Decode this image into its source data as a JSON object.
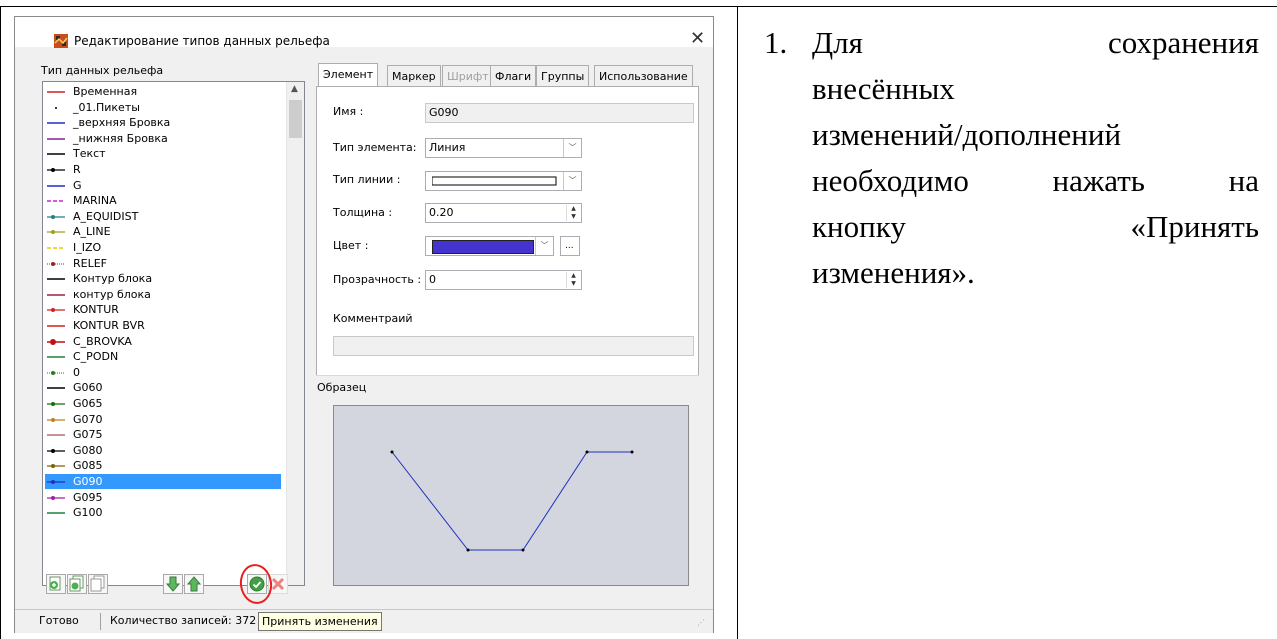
{
  "dialog": {
    "title": "Редактирование типов данных рельефа",
    "close_symbol": "✕",
    "list_label": "Тип данных рельефа",
    "list_items": [
      {
        "label": "Временная",
        "color": "#d02020",
        "style": "line"
      },
      {
        "label": "_01.Пикеты",
        "color": "#000000",
        "style": "dot"
      },
      {
        "label": "_верхняя Бровка",
        "color": "#2030c0",
        "style": "line"
      },
      {
        "label": "_нижняя Бровка",
        "color": "#8a2090",
        "style": "line"
      },
      {
        "label": "Текст",
        "color": "#000000",
        "style": "line"
      },
      {
        "label": "R",
        "color": "#000000",
        "style": "marker"
      },
      {
        "label": "G",
        "color": "#2030c0",
        "style": "line"
      },
      {
        "label": "MARINA",
        "color": "#d020d0",
        "style": "dash"
      },
      {
        "label": "A_EQUIDIST",
        "color": "#208080",
        "style": "marker"
      },
      {
        "label": "A_LINE",
        "color": "#a0a020",
        "style": "marker"
      },
      {
        "label": "I_IZO",
        "color": "#e0d000",
        "style": "dash"
      },
      {
        "label": "RELEF",
        "color": "#a02020",
        "style": "dotmarker"
      },
      {
        "label": "Контур блока",
        "color": "#000000",
        "style": "line"
      },
      {
        "label": "контур блока",
        "color": "#a02040",
        "style": "line"
      },
      {
        "label": "KONTUR",
        "color": "#d02020",
        "style": "marker"
      },
      {
        "label": "KONTUR BVR",
        "color": "#d02020",
        "style": "line"
      },
      {
        "label": "C_BROVKA",
        "color": "#c01010",
        "style": "bigmarker"
      },
      {
        "label": "C_PODN",
        "color": "#208040",
        "style": "line"
      },
      {
        "label": "0",
        "color": "#208020",
        "style": "dotmarker"
      },
      {
        "label": "G060",
        "color": "#000000",
        "style": "line"
      },
      {
        "label": "G065",
        "color": "#107010",
        "style": "marker"
      },
      {
        "label": "G070",
        "color": "#c08020",
        "style": "marker"
      },
      {
        "label": "G075",
        "color": "#b07070",
        "style": "line"
      },
      {
        "label": "G080",
        "color": "#000000",
        "style": "marker"
      },
      {
        "label": "G085",
        "color": "#806000",
        "style": "marker"
      },
      {
        "label": "G090",
        "color": "#2030c0",
        "style": "marker"
      },
      {
        "label": "G095",
        "color": "#a020a0",
        "style": "marker"
      },
      {
        "label": "G100",
        "color": "#208040",
        "style": "line"
      }
    ],
    "selected_index": 25,
    "tabs": [
      {
        "label": "Элемент",
        "active": true,
        "disabled": false
      },
      {
        "label": "Маркер",
        "active": false,
        "disabled": false
      },
      {
        "label": "Шрифт",
        "active": false,
        "disabled": true
      },
      {
        "label": "Флаги",
        "active": false,
        "disabled": false
      },
      {
        "label": "Группы",
        "active": false,
        "disabled": false
      },
      {
        "label": "Использование",
        "active": false,
        "disabled": false
      }
    ],
    "form": {
      "name_label": "Имя :",
      "name_value": "G090",
      "element_type_label": "Тип элемента:",
      "element_type_value": "Линия",
      "line_type_label": "Тип линии :",
      "thickness_label": "Толщина :",
      "thickness_value": "0.20",
      "color_label": "Цвет :",
      "color_value": "#4433cc",
      "color_more": "...",
      "transparency_label": "Прозрачность :",
      "transparency_value": "0",
      "comment_label": "Комментраий",
      "comment_value": ""
    },
    "sample_label": "Образец",
    "sample_line_color": "#2030c0",
    "toolbar_icons": [
      "add-icon",
      "add-copy-icon",
      "copy-icon",
      "move-down-icon",
      "move-up-icon",
      "accept-icon",
      "delete-icon"
    ],
    "status_ready": "Готово",
    "status_count": "Количество записей: 372",
    "tooltip": "Принять изменения"
  },
  "note": {
    "number": "1.",
    "lines": [
      [
        "Для",
        "сохранения"
      ],
      [
        "внесённых"
      ],
      [
        "изменений/дополнений"
      ],
      [
        "необходимо",
        "нажать",
        "на"
      ],
      [
        "кнопку",
        "«Принять"
      ],
      [
        "изменения»."
      ]
    ]
  }
}
